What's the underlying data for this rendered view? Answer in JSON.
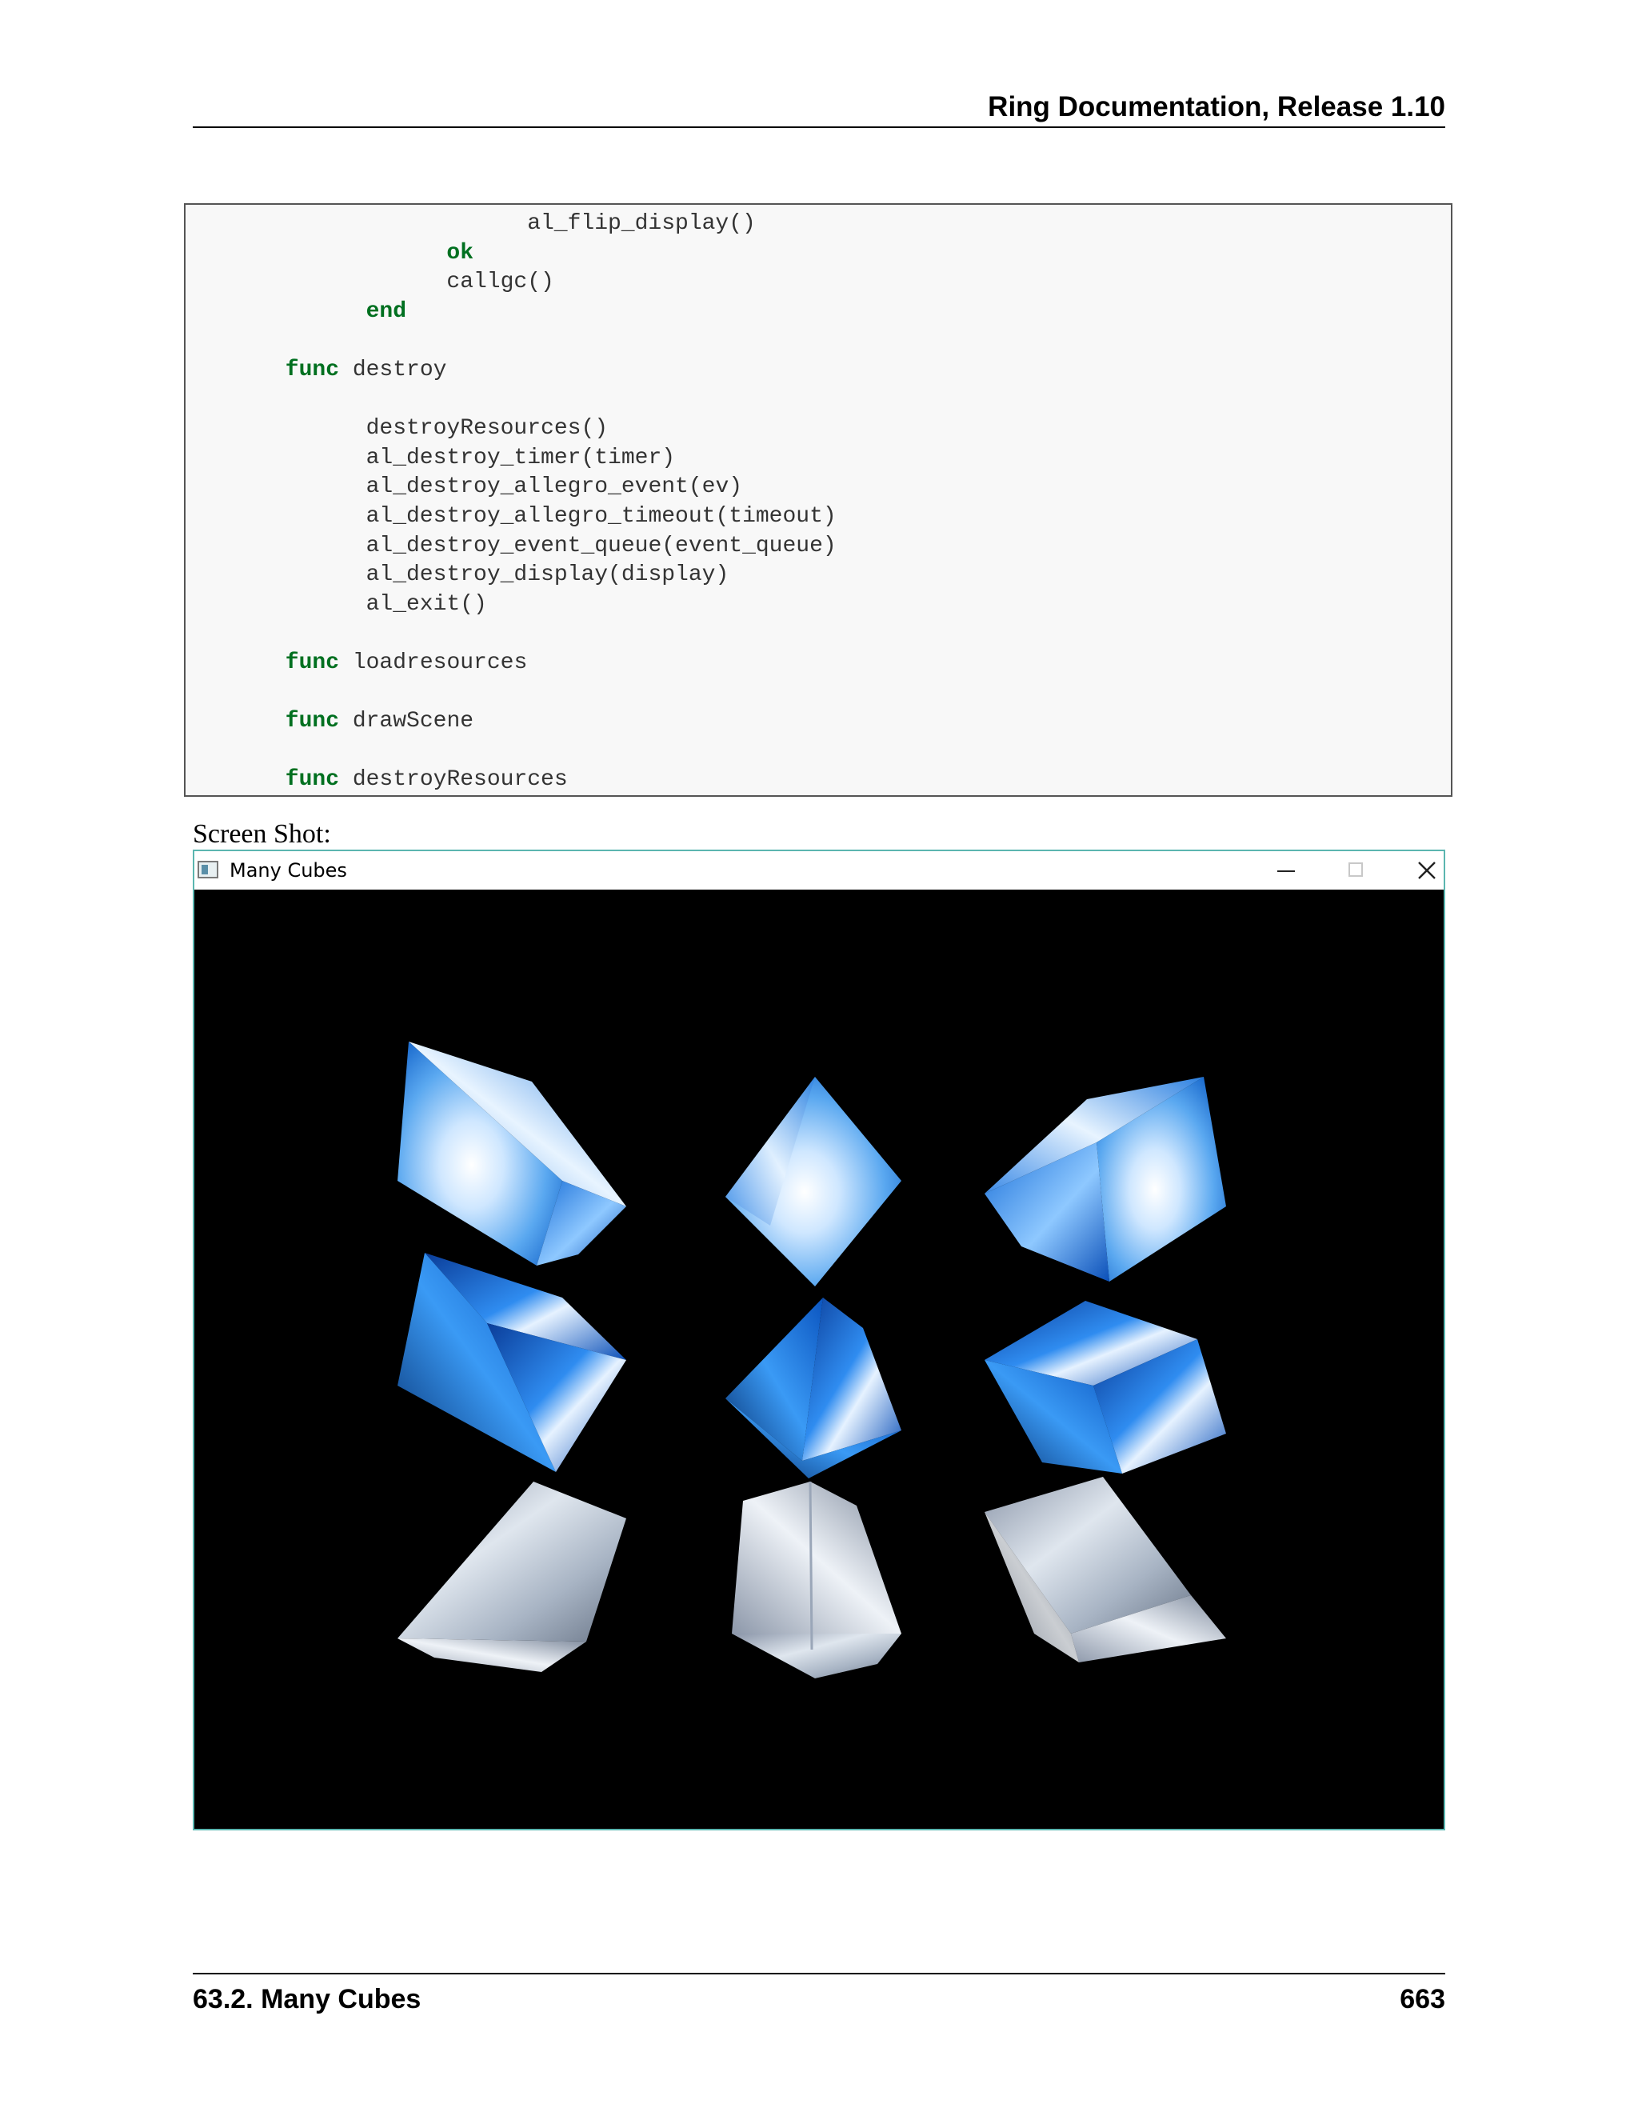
{
  "header": {
    "title": "Ring Documentation, Release 1.10"
  },
  "code": {
    "lines": [
      {
        "text": "al_flip_display()",
        "indent": 24,
        "kw": false
      },
      {
        "text": "ok",
        "indent": 18,
        "kw": true
      },
      {
        "text": "callgc()",
        "indent": 18,
        "kw": false
      },
      {
        "text": "end",
        "indent": 12,
        "kw": true
      },
      {
        "text": "",
        "indent": 0,
        "kw": false
      },
      {
        "text": "func destroy",
        "indent": 6,
        "kw": "func"
      },
      {
        "text": "",
        "indent": 0,
        "kw": false
      },
      {
        "text": "destroyResources()",
        "indent": 12,
        "kw": false
      },
      {
        "text": "al_destroy_timer(timer)",
        "indent": 12,
        "kw": false
      },
      {
        "text": "al_destroy_allegro_event(ev)",
        "indent": 12,
        "kw": false
      },
      {
        "text": "al_destroy_allegro_timeout(timeout)",
        "indent": 12,
        "kw": false
      },
      {
        "text": "al_destroy_event_queue(event_queue)",
        "indent": 12,
        "kw": false
      },
      {
        "text": "al_destroy_display(display)",
        "indent": 12,
        "kw": false
      },
      {
        "text": "al_exit()",
        "indent": 12,
        "kw": false
      },
      {
        "text": "",
        "indent": 0,
        "kw": false
      },
      {
        "text": "func loadresources",
        "indent": 6,
        "kw": "func"
      },
      {
        "text": "",
        "indent": 0,
        "kw": false
      },
      {
        "text": "func drawScene",
        "indent": 6,
        "kw": "func"
      },
      {
        "text": "",
        "indent": 0,
        "kw": false
      },
      {
        "text": "func destroyResources",
        "indent": 6,
        "kw": "func"
      }
    ]
  },
  "caption": "Screen Shot:",
  "window": {
    "title": "Many Cubes",
    "icons": {
      "app": "app-window-icon",
      "minimize": "minimize-icon",
      "maximize": "maximize-icon",
      "close": "close-icon"
    }
  },
  "colors": {
    "keyword": "#007020",
    "sky_light": "#e8f4ff",
    "sky_mid": "#5aa8f0",
    "sky_deep": "#0a5cc8",
    "cloud_grey": "#c8d0dc",
    "cloud_dark": "#6a7688"
  },
  "footer": {
    "section": "63.2.  Many Cubes",
    "page": "663"
  }
}
